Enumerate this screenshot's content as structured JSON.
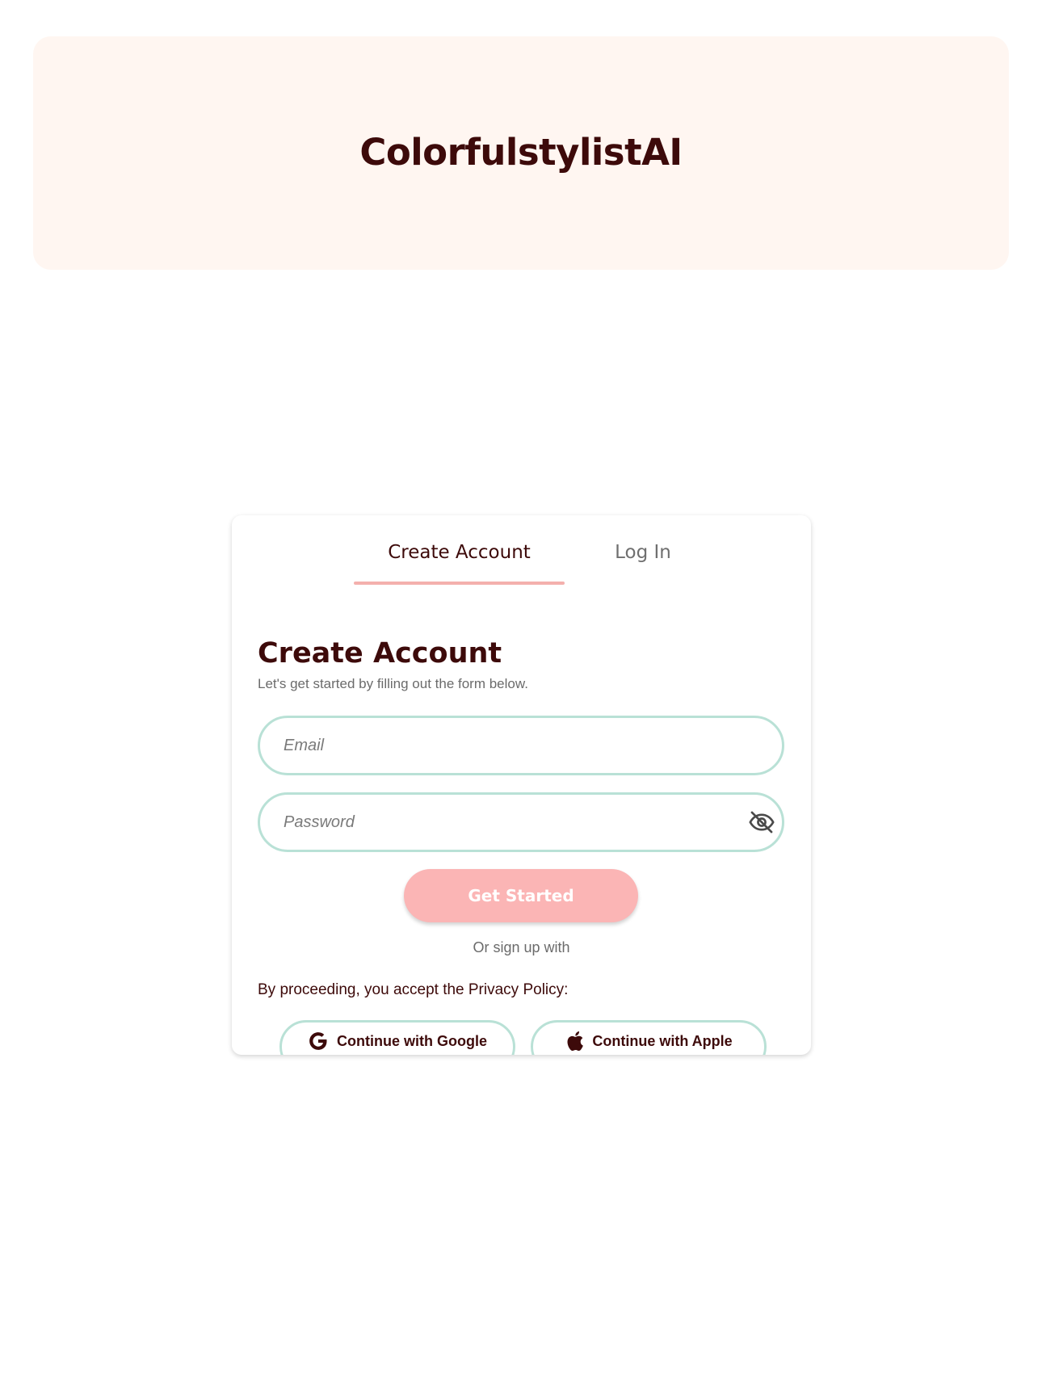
{
  "app": {
    "title": "ColorfulstylistAI"
  },
  "tabs": [
    {
      "label": "Create Account",
      "active": true
    },
    {
      "label": "Log In",
      "active": false
    }
  ],
  "form": {
    "heading": "Create Account",
    "subtitle": "Let's get started by filling out the form below.",
    "email": {
      "placeholder": "Email",
      "value": ""
    },
    "password": {
      "placeholder": "Password",
      "value": "",
      "toggle_icon": "eye-off-icon"
    },
    "submit_label": "Get Started",
    "or_text": "Or sign up with",
    "privacy_text": "By proceeding, you accept the Privacy Policy:"
  },
  "social": {
    "google": {
      "label": "Continue with Google",
      "icon": "google-icon"
    },
    "apple": {
      "label": "Continue with Apple",
      "icon": "apple-icon"
    }
  },
  "colors": {
    "banner_bg": "#fff6f1",
    "brand_text": "#3d0a0a",
    "accent_pink": "#fbb5b5",
    "tab_underline": "#f4b0ad",
    "field_border": "#b9e1d6"
  }
}
